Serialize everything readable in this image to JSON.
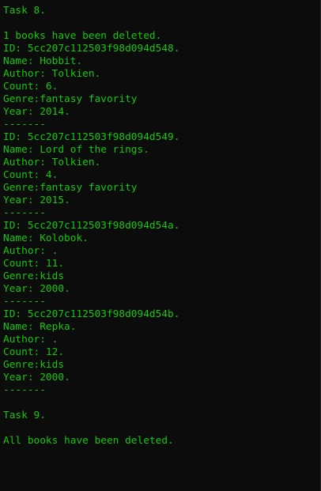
{
  "terminal": {
    "lines": [
      "Task 8.",
      "",
      "1 books have been deleted.",
      "ID: 5cc207c112503f98d094d548.",
      "Name: Hobbit.",
      "Author: Tolkien.",
      "Count: 6.",
      "Genre:fantasy favority",
      "Year: 2014.",
      "-------",
      "ID: 5cc207c112503f98d094d549.",
      "Name: Lord of the rings.",
      "Author: Tolkien.",
      "Count: 4.",
      "Genre:fantasy favority",
      "Year: 2015.",
      "-------",
      "ID: 5cc207c112503f98d094d54a.",
      "Name: Kolobok.",
      "Author: .",
      "Count: 11.",
      "Genre:kids",
      "Year: 2000.",
      "-------",
      "ID: 5cc207c112503f98d094d54b.",
      "Name: Repka.",
      "Author: .",
      "Count: 12.",
      "Genre:kids",
      "Year: 2000.",
      "-------",
      "",
      "Task 9.",
      "",
      "All books have been deleted."
    ],
    "text_color": "#16c60c",
    "background_color": "#0c0c0c"
  }
}
